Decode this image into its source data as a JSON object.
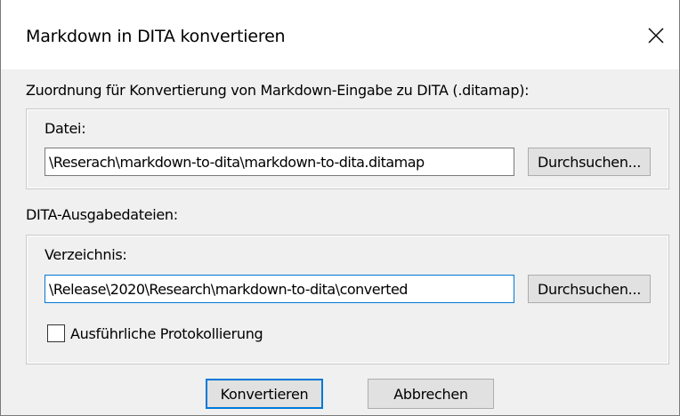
{
  "window": {
    "title": "Markdown in DITA konvertieren"
  },
  "mapping_section": {
    "label": "Zuordnung für Konvertierung von Markdown-Eingabe zu DITA (.ditamap):",
    "file_label": "Datei:",
    "file_value": "\\Reserach\\markdown-to-dita\\markdown-to-dita.ditamap",
    "browse_label": "Durchsuchen..."
  },
  "output_section": {
    "label": "DITA-Ausgabedateien:",
    "directory_label": "Verzeichnis:",
    "directory_value": "\\Release\\2020\\Research\\markdown-to-dita\\converted",
    "browse_label": "Durchsuchen...",
    "verbose_logging_label": "Ausführliche Protokollierung",
    "verbose_logging_checked": false
  },
  "footer": {
    "convert_label": "Konvertieren",
    "cancel_label": "Abbrechen"
  }
}
